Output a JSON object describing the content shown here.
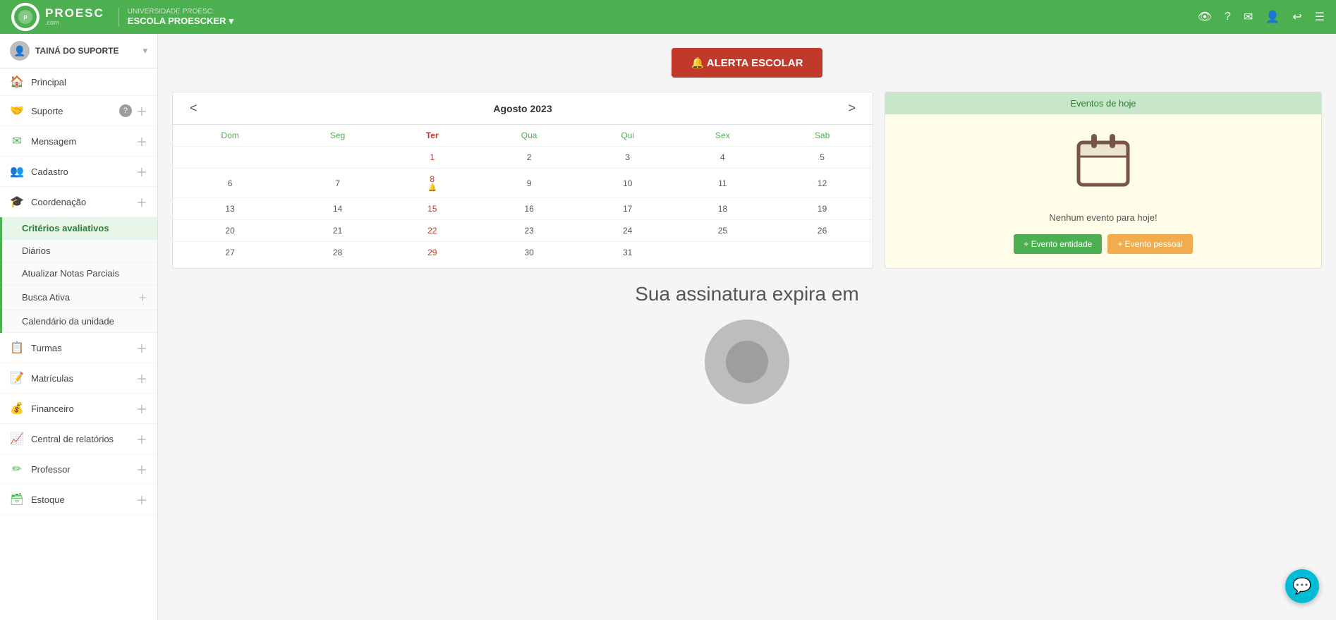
{
  "topbar": {
    "university_label": "UNIVERSIDADE PROESC:",
    "school_name": "ESCOLA PROESCKER",
    "logo_initials": "PROESC",
    "logo_sub": ".com"
  },
  "user": {
    "name": "TAINÁ DO SUPORTE",
    "dropdown_arrow": "▾"
  },
  "nav": {
    "principal": "Principal",
    "suporte": "Suporte",
    "mensagem": "Mensagem",
    "cadastro": "Cadastro",
    "coordenacao": "Coordenação",
    "turmas": "Turmas",
    "matriculas": "Matrículas",
    "financeiro": "Financeiro",
    "central_relatorios": "Central de relatórios",
    "professor": "Professor",
    "estoque": "Estoque"
  },
  "coordenacao_submenu": {
    "criterios": "Critérios avaliativos",
    "diarios": "Diários",
    "atualizar_notas": "Atualizar Notas Parciais",
    "busca_ativa": "Busca Ativa",
    "calendario": "Calendário da unidade"
  },
  "calendar": {
    "title": "Agosto 2023",
    "prev": "<",
    "next": ">",
    "days": [
      "Dom",
      "Seg",
      "Ter",
      "Qua",
      "Qui",
      "Sex",
      "Sab"
    ],
    "weeks": [
      [
        "",
        "",
        "1",
        "2",
        "3",
        "4",
        "5"
      ],
      [
        "6",
        "7",
        "8",
        "9",
        "10",
        "11",
        "12"
      ],
      [
        "13",
        "14",
        "15",
        "16",
        "17",
        "18",
        "19"
      ],
      [
        "20",
        "21",
        "22",
        "23",
        "24",
        "25",
        "26"
      ],
      [
        "27",
        "28",
        "29",
        "30",
        "31",
        "",
        ""
      ]
    ],
    "today_cell": "8",
    "today_week": 1,
    "today_day_index": 2
  },
  "events": {
    "header": "Eventos de hoje",
    "no_event": "Nenhum evento para hoje!",
    "btn_entity": "+ Evento entidade",
    "btn_personal": "+ Evento pessoal"
  },
  "alert": {
    "label": "🔔 ALERTA ESCOLAR"
  },
  "subscription": {
    "text": "Sua assinatura expira em"
  },
  "icons": {
    "home": "🏠",
    "suporte": "🤝",
    "mensagem": "✉",
    "cadastro": "👥",
    "coordenacao": "🎓",
    "turmas": "📋",
    "matriculas": "📝",
    "financeiro": "💰",
    "relatorios": "📈",
    "professor": "✏",
    "estoque": "🗃",
    "plus": "＋",
    "settings": "⚙",
    "help": "?",
    "mail": "✉",
    "user": "👤",
    "logout": "↩",
    "menu": "☰",
    "eye": "👁",
    "chat": "💬",
    "bell": "🔔",
    "calendar_big": "📅"
  }
}
